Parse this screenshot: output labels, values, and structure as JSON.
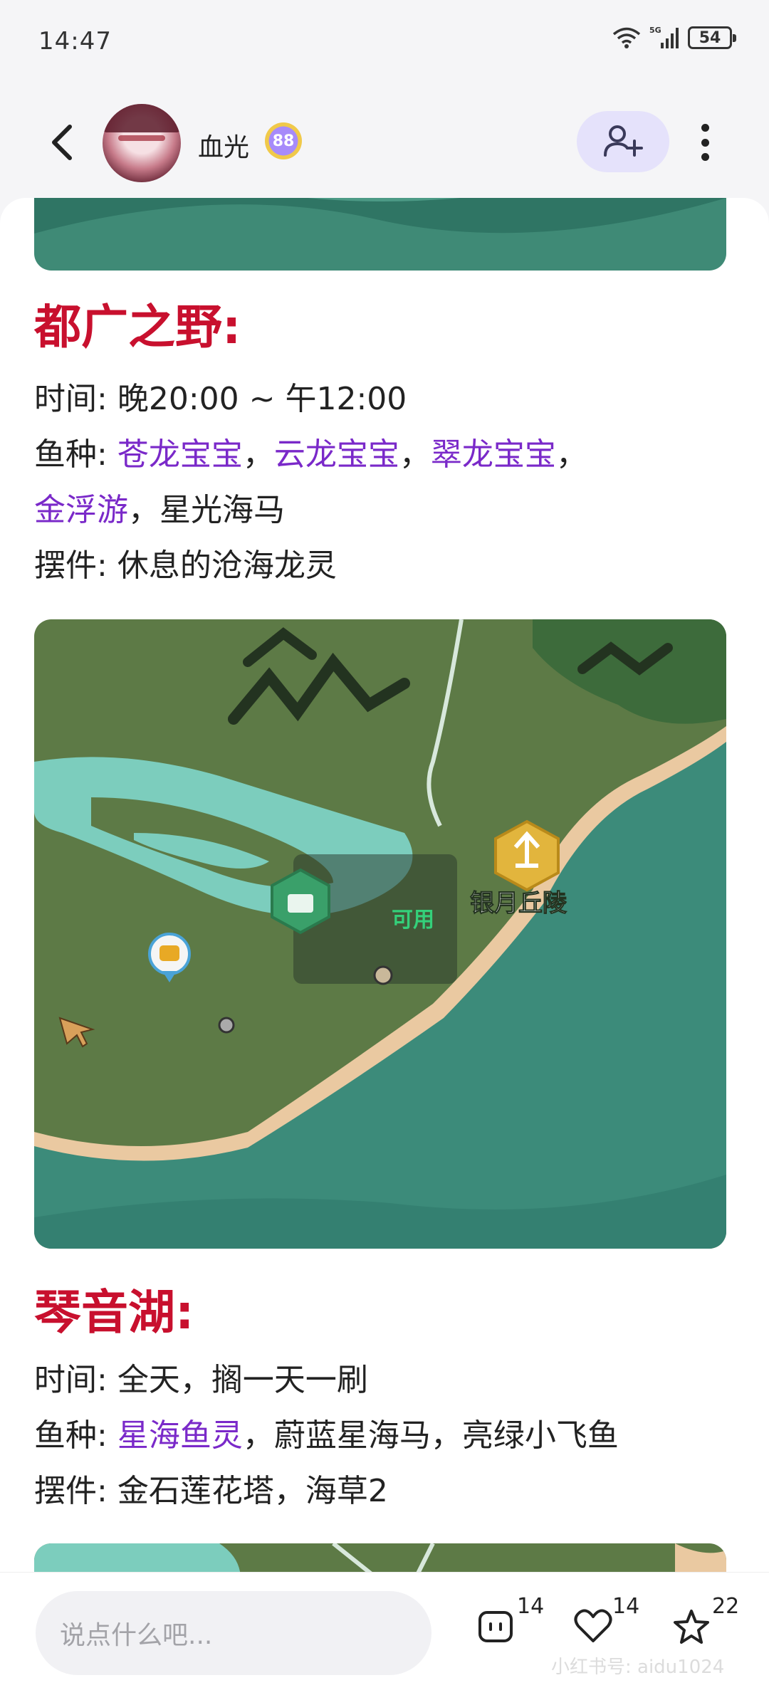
{
  "status_bar": {
    "time": "14:47",
    "network": "5G",
    "battery": "54"
  },
  "header": {
    "username": "血光",
    "level": "88"
  },
  "sections": [
    {
      "title": "都广之野:",
      "time_label": "时间:",
      "time_value": "晚20:00 ~ 午12:00",
      "fish_label": "鱼种:",
      "fish_highlight": [
        "苍龙宝宝",
        "云龙宝宝",
        "翠龙宝宝",
        "金浮游"
      ],
      "fish_plain": [
        "星光海马"
      ],
      "decor_label": "摆件:",
      "decor_value": "休息的沧海龙灵"
    },
    {
      "title": "琴音湖:",
      "time_label": "时间:",
      "time_value": "全天，搁一天一刷",
      "fish_label": "鱼种:",
      "fish_highlight": [
        "星海鱼灵"
      ],
      "fish_plain": [
        "蔚蓝星海马",
        "亮绿小飞鱼"
      ],
      "decor_label": "摆件:",
      "decor_value": "金石莲花塔，海草2"
    }
  ],
  "map": {
    "landmark_label": "银月丘陵",
    "status_label": "可用"
  },
  "bottom_bar": {
    "comment_placeholder": "说点什么吧...",
    "comments_count": "14",
    "likes_count": "14",
    "favorites_count": "22",
    "watermark": "小红书号: aidu1024"
  },
  "colors": {
    "section_title": "#c8102e",
    "highlight": "#7a29c9",
    "follow_bg": "#e5e2fb"
  }
}
